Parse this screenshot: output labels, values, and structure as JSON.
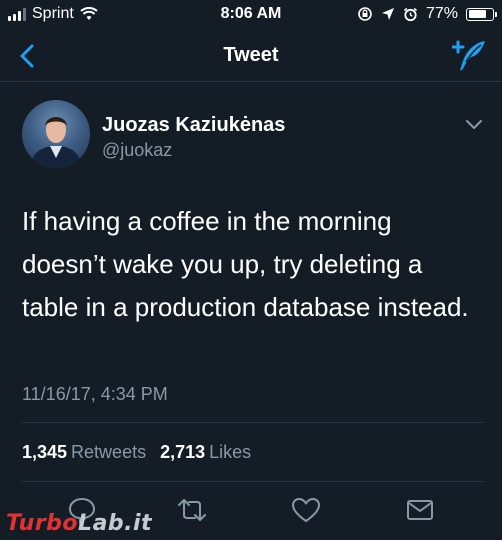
{
  "status_bar": {
    "carrier": "Sprint",
    "time": "8:06 AM",
    "battery_percent": "77%",
    "battery_level": 0.77,
    "icons": [
      "signal-icon",
      "wifi-icon",
      "orientation-lock-icon",
      "location-icon",
      "alarm-icon",
      "battery-icon"
    ]
  },
  "nav": {
    "title": "Tweet",
    "back_icon": "chevron-left-icon",
    "compose_icon": "compose-tweet-icon"
  },
  "tweet": {
    "author_name": "Juozas Kaziukėnas",
    "author_handle": "@juokaz",
    "text": "If having a coffee in the morning doesn’t wake you up, try deleting a table in a production database instead.",
    "timestamp": "11/16/17, 4:34 PM",
    "retweets_count": "1,345",
    "retweets_label": "Retweets",
    "likes_count": "2,713",
    "likes_label": "Likes"
  },
  "actions": [
    "reply-icon",
    "retweet-icon",
    "like-icon",
    "direct-message-icon"
  ],
  "watermark": {
    "part1": "Turbo",
    "part2": "Lab.it"
  },
  "colors": {
    "background": "#141d26",
    "accent": "#1da1f2",
    "secondary_text": "#8899a6",
    "divider": "#243447"
  }
}
